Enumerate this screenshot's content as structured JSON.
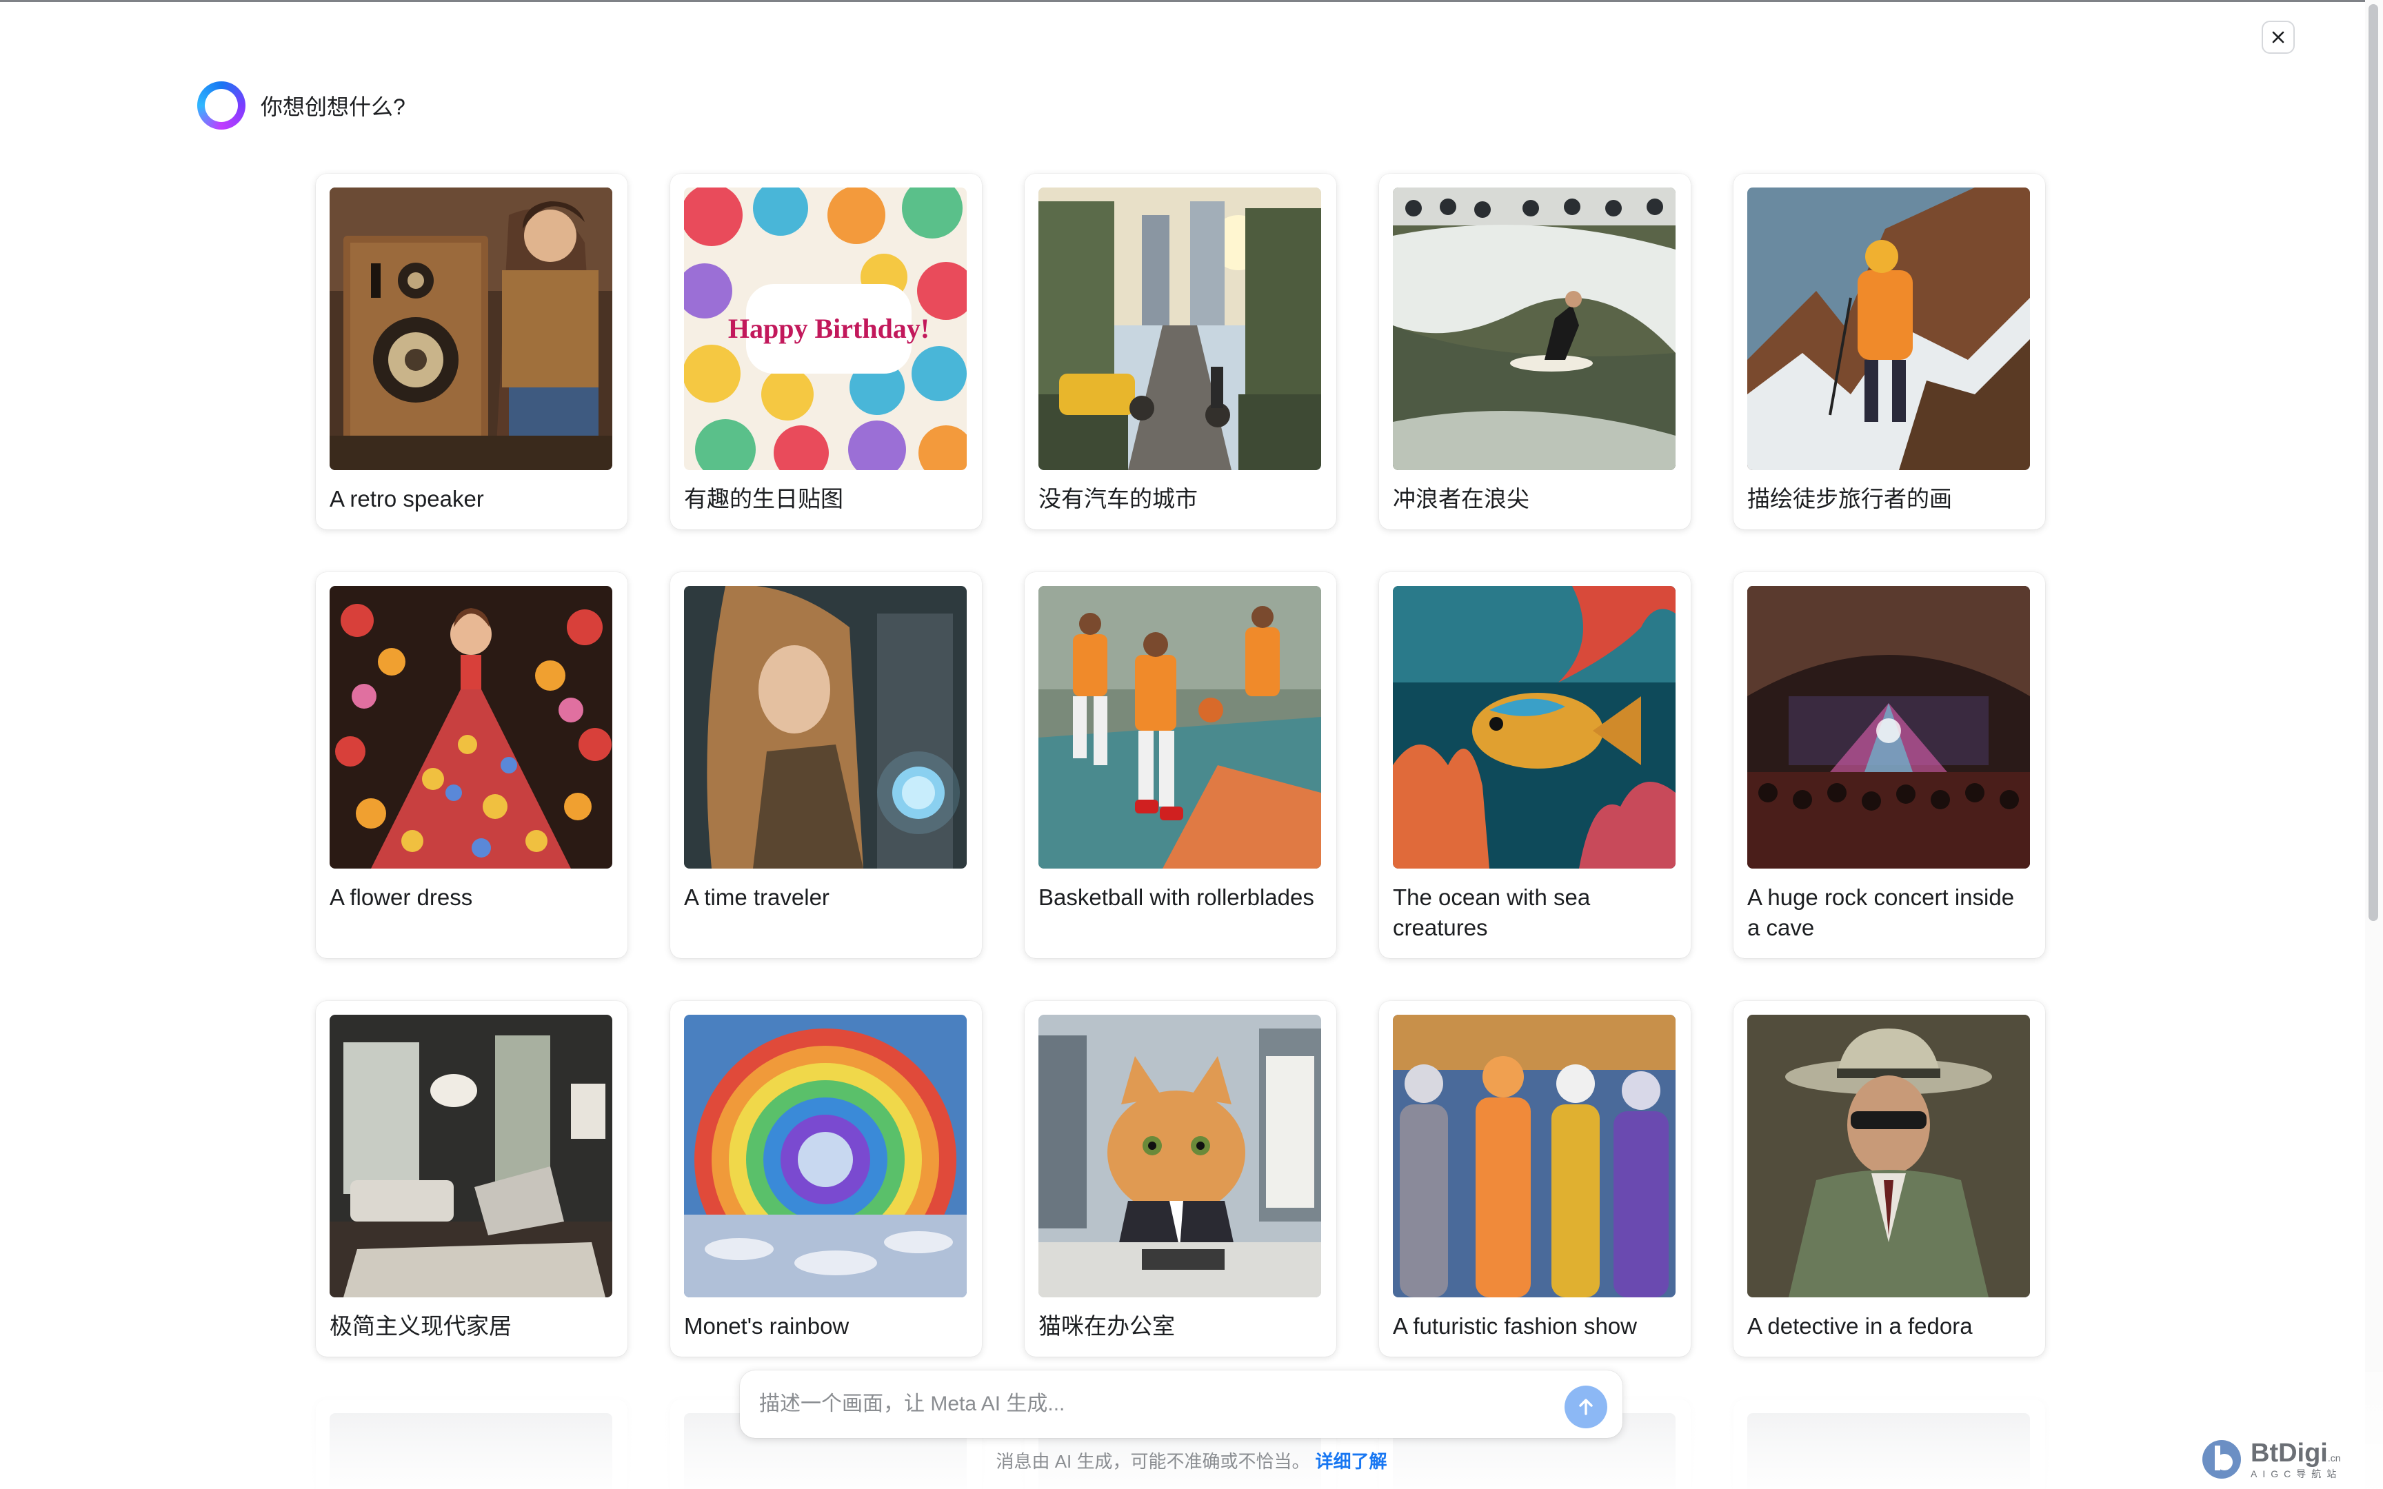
{
  "header": {
    "title": "你想创想什么?"
  },
  "cards": [
    {
      "label": "A retro speaker"
    },
    {
      "label": "有趣的生日贴图",
      "image_text": "Happy Birthday!"
    },
    {
      "label": "没有汽车的城市"
    },
    {
      "label": "冲浪者在浪尖"
    },
    {
      "label": "描绘徒步旅行者的画"
    },
    {
      "label": "A flower dress"
    },
    {
      "label": "A time traveler"
    },
    {
      "label": "Basketball with rollerblades"
    },
    {
      "label": "The ocean with sea creatures"
    },
    {
      "label": "A huge rock concert inside a cave"
    },
    {
      "label": "极简主义现代家居"
    },
    {
      "label": "Monet's rainbow"
    },
    {
      "label": "猫咪在办公室"
    },
    {
      "label": "A futuristic fashion show"
    },
    {
      "label": "A detective in a fedora"
    }
  ],
  "prompt": {
    "placeholder": "描述一个画面，让 Meta AI 生成..."
  },
  "disclaimer": {
    "text": "消息由 AI 生成，可能不准确或不恰当。",
    "link": "详细了解"
  },
  "watermark": {
    "brand": "BtDigi",
    "suffix": ".cn",
    "sub": "AIGC导航站"
  },
  "colors": {
    "accent": "#1877f2",
    "send_button": "#8cb8f5",
    "text": "#1c1e21",
    "muted": "#8a8d91"
  }
}
